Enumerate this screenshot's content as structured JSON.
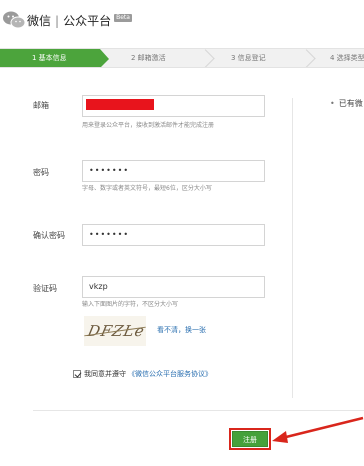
{
  "header": {
    "brand": "微信",
    "separator": "|",
    "platform": "公众平台",
    "badge": "Beta"
  },
  "steps": [
    {
      "label": "1 基本信息",
      "active": true
    },
    {
      "label": "2 邮箱激活",
      "active": false
    },
    {
      "label": "3 信息登记",
      "active": false
    },
    {
      "label": "4 选择类型",
      "active": false
    }
  ],
  "side_note": "已有微",
  "form": {
    "email": {
      "label": "邮箱",
      "value": "",
      "hint": "用来登录公众平台，接收到激活邮件才能完成注册"
    },
    "password": {
      "label": "密码",
      "value": "•••••••",
      "hint": "字母、数字或者英文符号，最短6位，区分大小写"
    },
    "confirm": {
      "label": "确认密码",
      "value": "•••••••"
    },
    "captcha": {
      "label": "验证码",
      "value": "vkzp",
      "hint": "输入下面图片的字符，不区分大小写",
      "image_text": "DFZLe",
      "refresh": "看不清，换一张"
    },
    "agree": {
      "prefix": "我同意并遵守",
      "link": "《微信公众平台服务协议》",
      "checked": true
    },
    "submit": "注册"
  },
  "colors": {
    "accent": "#4ca43c",
    "highlight": "#d9261c",
    "redaction": "#e8141c",
    "link": "#2a6fb0"
  }
}
